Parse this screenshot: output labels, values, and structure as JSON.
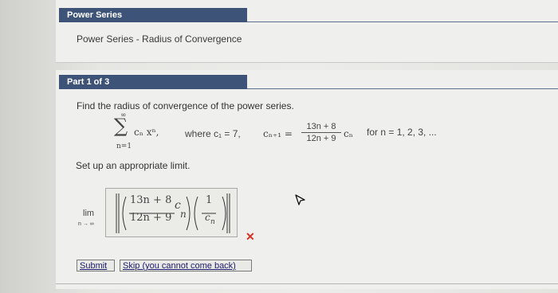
{
  "header": {
    "section_bar": "Power Series",
    "subtitle": "Power Series - Radius of Convergence"
  },
  "part": {
    "bar": "Part 1 of 3",
    "instruction": "Find the radius of convergence of the power series.",
    "series_sum": "∑",
    "sum_upper": "∞",
    "sum_lower": "n=1",
    "series_term": "cₙ xⁿ,",
    "where_label": "where c₁ = 7,",
    "recurrence_lhs": "cₙ₊₁ =",
    "recurrence_num": "13n + 8",
    "recurrence_den": "12n + 9",
    "recurrence_tail": "cₙ",
    "range": "for n = 1, 2, 3, ...",
    "prompt": "Set up an appropriate limit."
  },
  "answer": {
    "lim_label": "lim",
    "lim_sub": "n → ∞",
    "frac1_num": "13n + 8",
    "frac1_den": "12n + 9",
    "frac1_tail": "c",
    "frac1_tail_sub": "n",
    "frac2_num": "1",
    "frac2_den": "c",
    "frac2_den_sub": "n",
    "status_mark": "✕",
    "status_color": "#d93025"
  },
  "buttons": {
    "submit": "Submit",
    "skip": "Skip (you cannot come back)"
  }
}
